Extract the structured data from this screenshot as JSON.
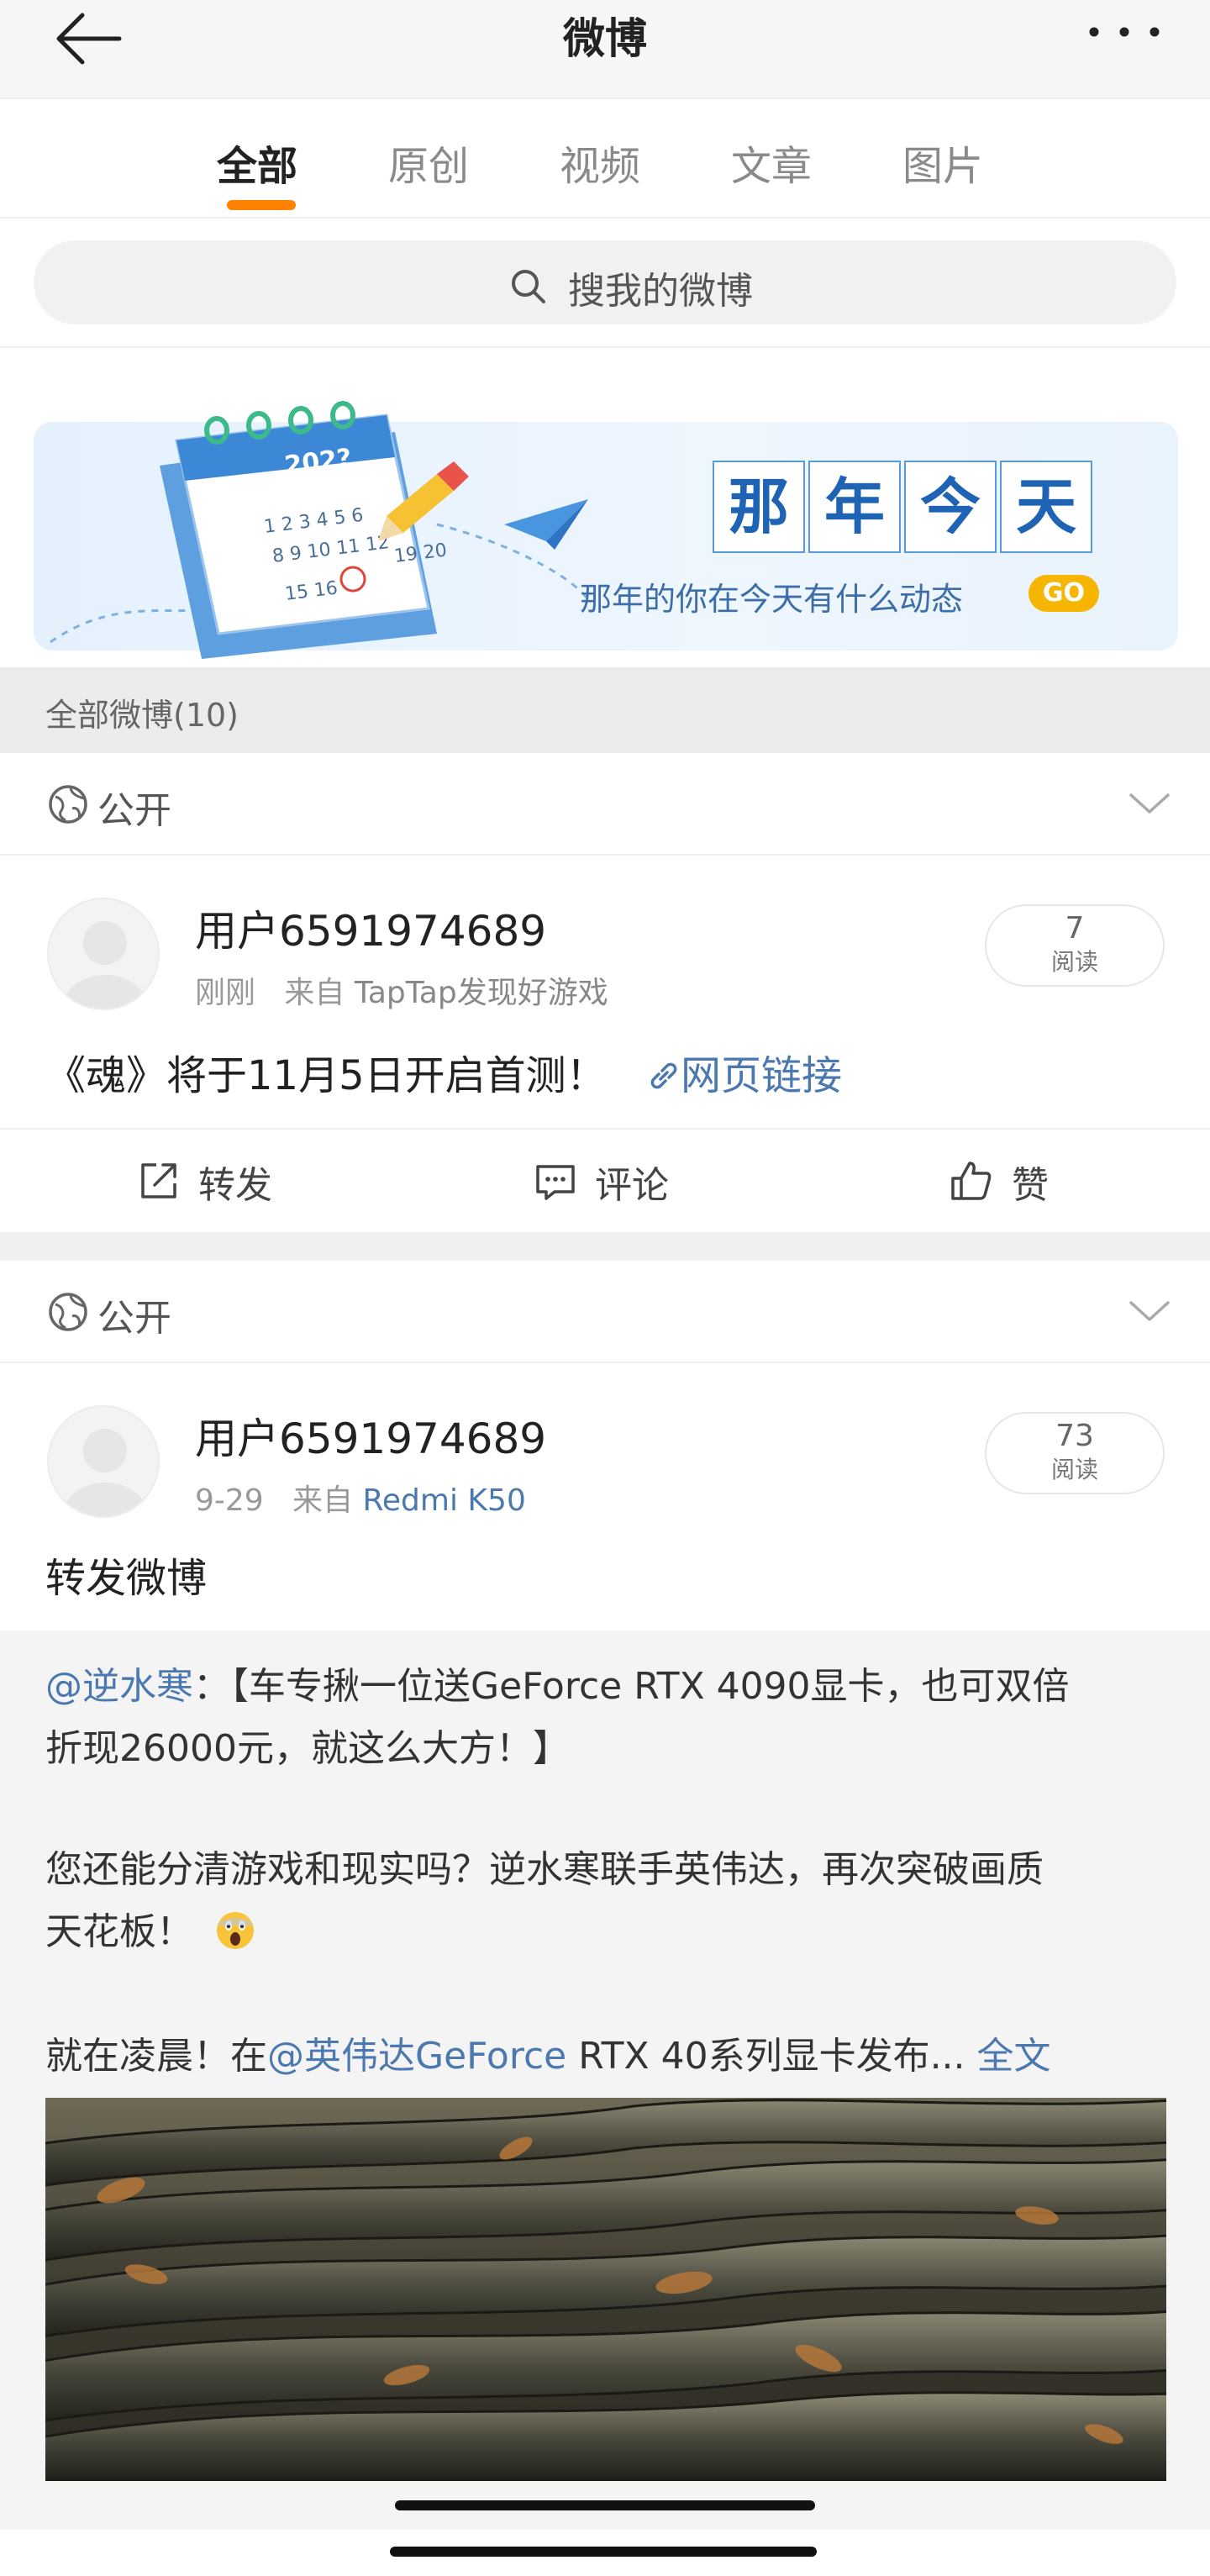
{
  "header": {
    "title": "微博",
    "back_icon": "back-arrow-icon",
    "more_icon": "more-dots-icon"
  },
  "tabs": [
    {
      "label": "全部",
      "active": true
    },
    {
      "label": "原创",
      "active": false
    },
    {
      "label": "视频",
      "active": false
    },
    {
      "label": "文章",
      "active": false
    },
    {
      "label": "图片",
      "active": false
    }
  ],
  "tab_accent": "#ff8200",
  "search": {
    "placeholder": "搜我的微博"
  },
  "banner": {
    "title_chars": [
      "那",
      "年",
      "今",
      "天"
    ],
    "subtitle": "那年的你在今天有什么动态",
    "go": "GO",
    "calendar_year": "202?",
    "calendar_numbers": [
      "1 2 3 4 5 6",
      "8 9 10 11 12",
      "15 16",
      "19 20"
    ]
  },
  "section": {
    "label": "全部微博(10)"
  },
  "posts": [
    {
      "visibility": "公开",
      "username": "用户6591974689",
      "time": "刚刚",
      "source_prefix": "来自",
      "source": "TapTap发现好游戏",
      "read_count": "7",
      "read_label": "阅读",
      "text": "《魂》将于11月5日开启首测！",
      "link_text": "网页链接",
      "actions": {
        "repost": "转发",
        "comment": "评论",
        "like": "赞"
      }
    },
    {
      "visibility": "公开",
      "username": "用户6591974689",
      "time": "9-29",
      "source_prefix": "来自",
      "source": "Redmi K50",
      "read_count": "73",
      "read_label": "阅读",
      "text": "转发微博",
      "repost": {
        "mention1": "@逆水寒",
        "line1_rest": "：【车专揪一位送GeForce RTX 4090显卡，也可双倍",
        "line2": "折现26000元，就这么大方！】",
        "line3": "您还能分清游戏和现实吗？逆水寒联手英伟达，再次突破画质",
        "line4": "天花板！",
        "emoji_icon": "scared-face-emoji-icon",
        "line5_prefix": "就在凌晨！在",
        "mention2": "@英伟达GeForce",
        "line5_rest": " RTX 40系列显卡发布...",
        "full_text": "全文"
      }
    }
  ],
  "colors": {
    "link": "#4c78b0",
    "muted": "#999999",
    "go_badge": "#f6b500"
  }
}
